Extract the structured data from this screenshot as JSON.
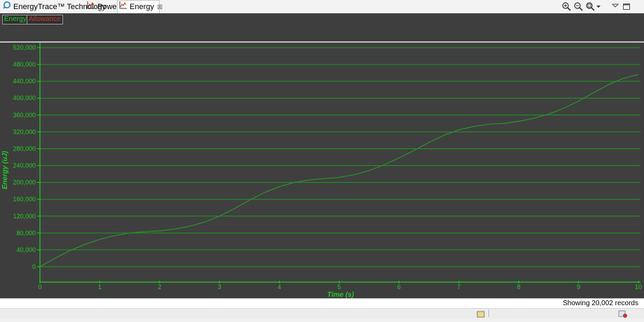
{
  "tabs": [
    {
      "label": "EnergyTrace™ Technology",
      "icon": "energytrace-icon"
    },
    {
      "label": "Power",
      "icon": "chart-icon"
    },
    {
      "label": "Energy",
      "icon": "chart-icon",
      "active": true,
      "closable": true
    }
  ],
  "toolbar": {
    "items": [
      "zoom-in-icon",
      "zoom-out-icon",
      "zoom-reset-icon",
      "dropdown-arrow-icon",
      "minimize-icon",
      "maximize-icon"
    ]
  },
  "legend": {
    "energy_label": "Energy",
    "allowance_label": "Allowance",
    "energy_color": "#22cc22",
    "allowance_color": "#c0392b"
  },
  "colors": {
    "plot_bg": "#3f3f3f",
    "grid": "#1f9a1f",
    "axis": "#22cc22",
    "line": "#2e8b2e"
  },
  "status": {
    "records": "Showing 20,002 records"
  },
  "chart_data": {
    "type": "line",
    "title": "",
    "xlabel": "Time  (s)",
    "ylabel": "Energy  (uJ)",
    "xlim": [
      0,
      10
    ],
    "ylim": [
      0,
      520000
    ],
    "xticks": [
      "0",
      "1",
      "2",
      "3",
      "4",
      "5",
      "6",
      "7",
      "8",
      "9",
      "10"
    ],
    "yticks": [
      "0",
      "40,000",
      "80,000",
      "120,000",
      "160,000",
      "200,000",
      "240,000",
      "280,000",
      "320,000",
      "360,000",
      "400,000",
      "440,000",
      "480,000",
      "520,000"
    ],
    "grid": true,
    "series": [
      {
        "name": "Energy",
        "x": [
          0,
          0.25,
          0.5,
          0.75,
          1,
          1.25,
          1.5,
          1.75,
          2,
          2.25,
          2.5,
          2.75,
          3,
          3.25,
          3.5,
          3.75,
          4,
          4.25,
          4.5,
          4.75,
          5,
          5.25,
          5.5,
          5.75,
          6,
          6.25,
          6.5,
          6.75,
          7,
          7.25,
          7.5,
          7.75,
          8,
          8.25,
          8.5,
          8.75,
          9,
          9.25,
          9.5,
          9.75,
          10
        ],
        "y": [
          0,
          20000,
          38000,
          53000,
          65000,
          74000,
          80000,
          83000,
          85000,
          89000,
          96000,
          106000,
          120000,
          138000,
          158000,
          176000,
          190000,
          200000,
          206000,
          209000,
          212000,
          218000,
          228000,
          242000,
          258000,
          276000,
          295000,
          312000,
          325000,
          333000,
          338000,
          340000,
          345000,
          352000,
          362000,
          376000,
          393000,
          413000,
          432000,
          447000,
          456000
        ]
      }
    ]
  }
}
